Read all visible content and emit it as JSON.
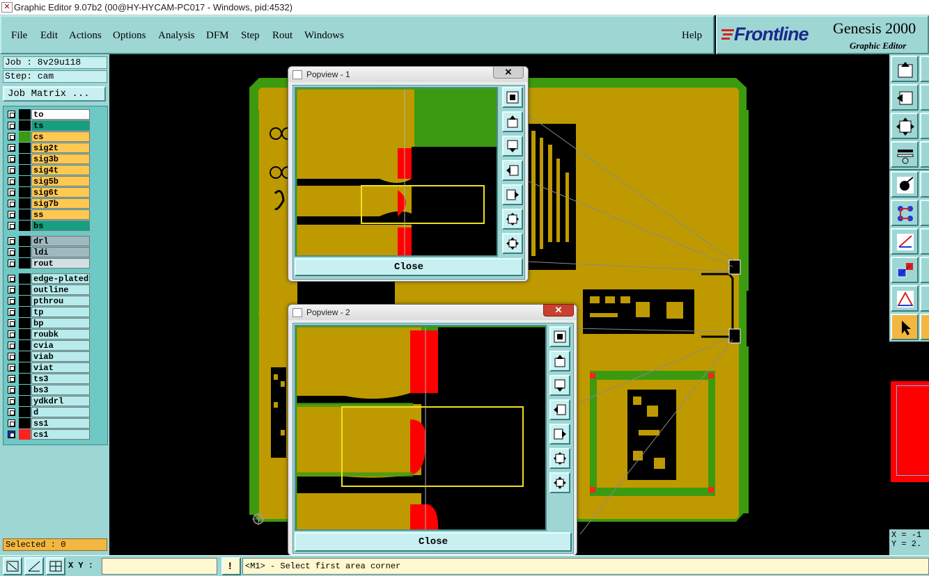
{
  "window": {
    "title": "Graphic Editor 9.07b2 (00@HY-HYCAM-PC017 - Windows, pid:4532)"
  },
  "menu": {
    "items": [
      "File",
      "Edit",
      "Actions",
      "Options",
      "Analysis",
      "DFM",
      "Step",
      "Rout",
      "Windows"
    ],
    "help": "Help"
  },
  "brand": {
    "logo": "Frontline",
    "product": "Genesis 2000",
    "subtitle": "Graphic Editor"
  },
  "job": {
    "job_label": "Job : 8v29u118",
    "step_label": "Step: cam",
    "matrix_button": "Job Matrix ..."
  },
  "layers": [
    {
      "name": "to",
      "color": "#ffffff",
      "swatch": "#000000"
    },
    {
      "name": "ts",
      "color": "#15a080",
      "swatch": "#000000"
    },
    {
      "name": "cs",
      "color": "#ffc850",
      "swatch": "#3c9a10"
    },
    {
      "name": "sig2t",
      "color": "#ffc850",
      "swatch": "#000000"
    },
    {
      "name": "sig3b",
      "color": "#ffc850",
      "swatch": "#000000"
    },
    {
      "name": "sig4t",
      "color": "#ffc850",
      "swatch": "#000000"
    },
    {
      "name": "sig5b",
      "color": "#ffc850",
      "swatch": "#000000"
    },
    {
      "name": "sig6t",
      "color": "#ffc850",
      "swatch": "#000000"
    },
    {
      "name": "sig7b",
      "color": "#ffc850",
      "swatch": "#000000"
    },
    {
      "name": "ss",
      "color": "#ffc850",
      "swatch": "#000000"
    },
    {
      "name": "bs",
      "color": "#15a080",
      "swatch": "#000000"
    },
    {
      "name": "drl",
      "color": "#a0b8c0",
      "swatch": "#000000"
    },
    {
      "name": "ldi",
      "color": "#a0b8c0",
      "swatch": "#000000"
    },
    {
      "name": "rout",
      "color": "#d0e0e4",
      "swatch": "#000000"
    },
    {
      "name": "edge-plated",
      "color": "#b8ecec",
      "swatch": "#000000"
    },
    {
      "name": "outline",
      "color": "#b8ecec",
      "swatch": "#000000"
    },
    {
      "name": "pthrou",
      "color": "#b8ecec",
      "swatch": "#000000"
    },
    {
      "name": "tp",
      "color": "#b8ecec",
      "swatch": "#000000"
    },
    {
      "name": "bp",
      "color": "#b8ecec",
      "swatch": "#000000"
    },
    {
      "name": "roubk",
      "color": "#b8ecec",
      "swatch": "#000000"
    },
    {
      "name": "cvia",
      "color": "#b8ecec",
      "swatch": "#000000"
    },
    {
      "name": "viab",
      "color": "#b8ecec",
      "swatch": "#000000"
    },
    {
      "name": "viat",
      "color": "#b8ecec",
      "swatch": "#000000"
    },
    {
      "name": "ts3",
      "color": "#b8ecec",
      "swatch": "#000000"
    },
    {
      "name": "bs3",
      "color": "#b8ecec",
      "swatch": "#000000"
    },
    {
      "name": "ydkdrl",
      "color": "#b8ecec",
      "swatch": "#000000"
    },
    {
      "name": "d",
      "color": "#b8ecec",
      "swatch": "#000000"
    },
    {
      "name": "ss1",
      "color": "#b8ecec",
      "swatch": "#000000"
    },
    {
      "name": "cs1",
      "color": "#b8ecec",
      "swatch": "#ff2020"
    }
  ],
  "selected": "Selected : 0",
  "popview1": {
    "title": "Popview - 1",
    "close": "Close"
  },
  "popview2": {
    "title": "Popview - 2",
    "close": "Close"
  },
  "status": {
    "xy_label": "X Y :",
    "xy_value": "",
    "message": "<M1> - Select first area corner"
  },
  "coords": {
    "x": "X = -1",
    "y": "Y = 2."
  }
}
